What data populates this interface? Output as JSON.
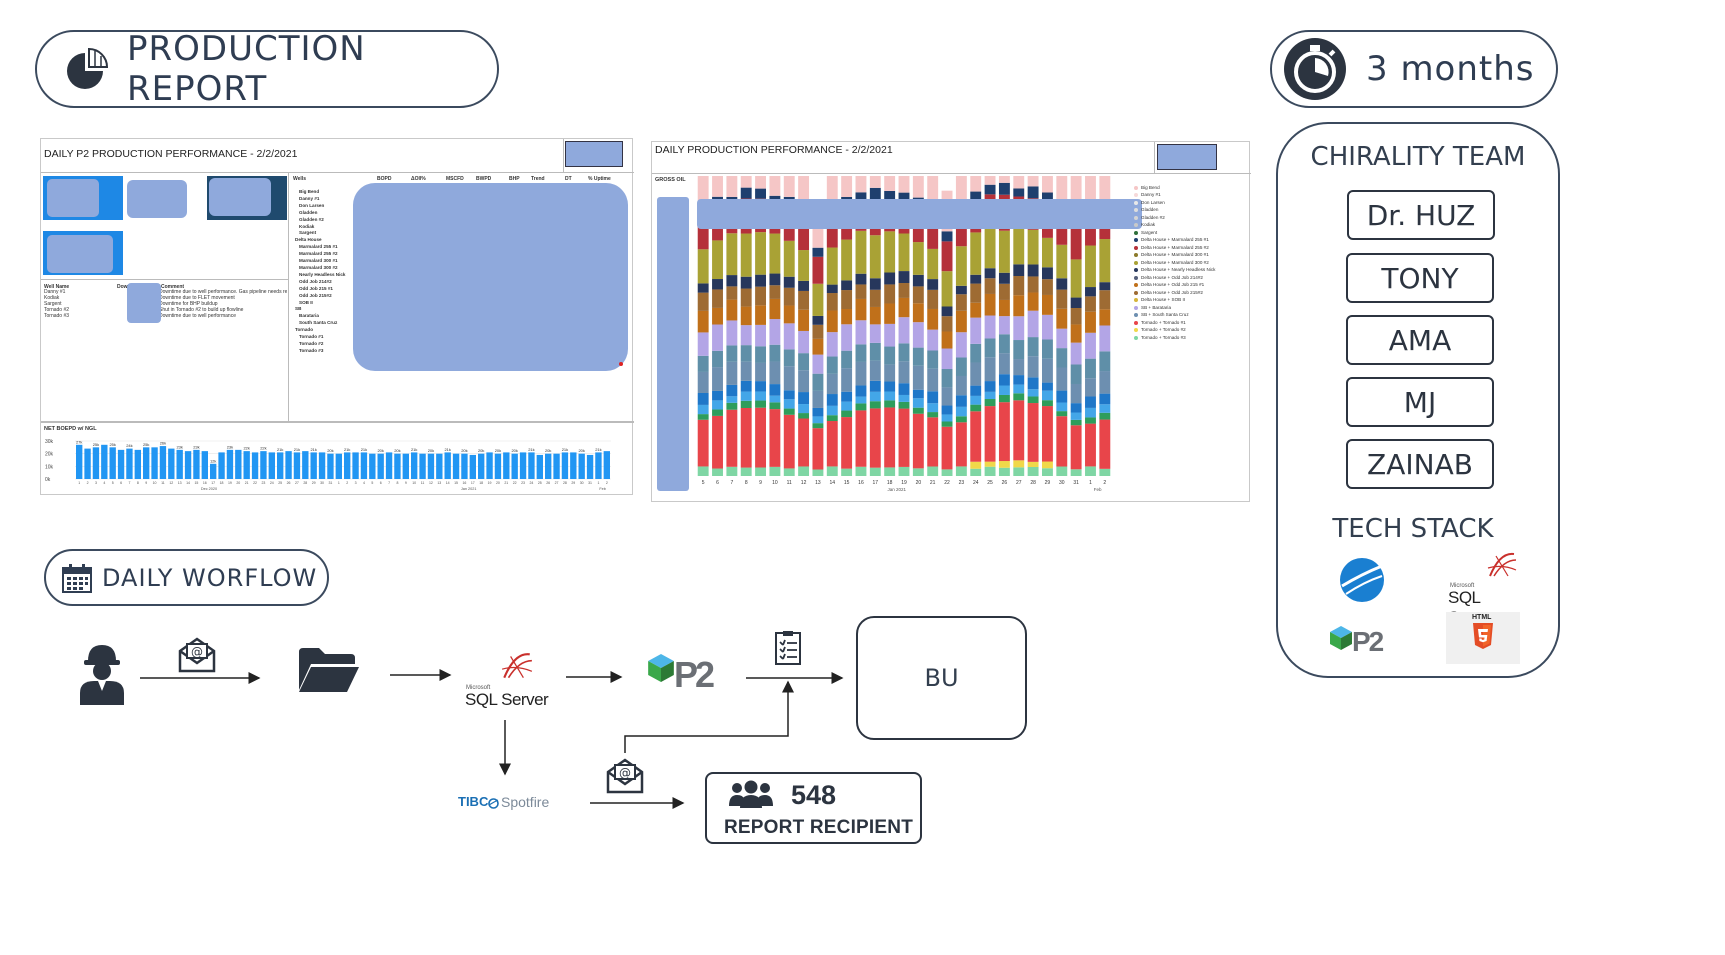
{
  "header": {
    "title": "PRODUCTION REPORT",
    "duration": "3 months"
  },
  "team": {
    "title": "CHIRALITY TEAM",
    "members": [
      "Dr. HUZ",
      "TONY",
      "AMA",
      "MJ",
      "ZAINAB"
    ]
  },
  "tech": {
    "title": "TECH STACK",
    "items": [
      "TIBCO Spotfire",
      "SQL Server",
      "P2",
      "HTML5"
    ],
    "sql_small": "Microsoft",
    "sql_label": "SQL Server",
    "p2_label": "P2",
    "html_label": "HTML"
  },
  "workflow": {
    "title": "DAILY WORFLOW",
    "bu_label": "BU",
    "recipients_count": "548",
    "recipients_label": "REPORT RECIPIENT",
    "sql_small": "Microsoft",
    "sql_label": "SQL Server",
    "p2_label": "P2",
    "spotfire_prefix": "TIBC",
    "spotfire_label": "Spotfire"
  },
  "screenshot1": {
    "title": "DAILY P2 PRODUCTION PERFORMANCE - 2/2/2021",
    "columns": [
      "Wells",
      "BOPD",
      "ΔOIl%",
      "MSCFD",
      "BWPD",
      "BHP",
      "Trend",
      "DT",
      "% Uptime"
    ],
    "wells": [
      "Big Bend",
      "Danny #1",
      "Don Larsen",
      "Gladden",
      "Gladden #2",
      "Kodiak",
      "Sargent",
      "Delta House",
      "Marmalard 255 #1",
      "Marmalard 255 #2",
      "Marmalard 300 #1",
      "Marmalard 300 #2",
      "Nearly Headless Nick",
      "Odd Job 214#2",
      "Odd Job 215 #1",
      "Odd Job 215#2",
      "SOB II",
      "SB",
      "Barataria",
      "South Santa Cruz",
      "Tornado",
      "Tornado #1",
      "Tornado #2",
      "Tornado #3"
    ],
    "notes_headers": [
      "Well Name",
      "Downtime",
      "Comment"
    ],
    "notes_wells": [
      "Danny #1",
      "Kodiak",
      "Sargent",
      "Tornado #2",
      "Tornado #3"
    ],
    "notes_comments": [
      "Downtime due to well performance. Gas pipeline needs repair",
      "Downtime due to FLET movement",
      "Downtime for BHP buildup",
      "Shut in Tornado #2 to build up flowline",
      "Downtime due to well performance"
    ],
    "chart_title": "NET BOEPD w/ NGL"
  },
  "screenshot2": {
    "title": "DAILY PRODUCTION PERFORMANCE - 2/2/2021",
    "chart_title": "GROSS OIL",
    "legend": [
      "Big Bend",
      "Danny #1",
      "Don Larsen",
      "Gladden",
      "Gladden #2",
      "Kodiak",
      "Sargent",
      "Delta House + Marmalard 255 #1",
      "Delta House + Marmalard 255 #2",
      "Delta House + Marmalard 300 #1",
      "Delta House + Marmalard 300 #2",
      "Delta House + Nearly Headless Nick",
      "Delta House + Odd Job 214#2",
      "Delta House + Odd Job 215 #1",
      "Delta House + Odd Job 215#2",
      "Delta House + SOB II",
      "SB + Barataria",
      "SB + South Santa Cruz",
      "Tornado + Tornado #1",
      "Tornado + Tornado #2",
      "Tornado + Tornado #3"
    ],
    "legend_colors": [
      "#f5c6c6",
      "#f6d9d9",
      "#e8e8e8",
      "#dddddd",
      "#d4d4d4",
      "#c9c9c9",
      "#2f6f3a",
      "#1f3f6e",
      "#b5313a",
      "#8c7a2a",
      "#a9a235",
      "#27375c",
      "#555f7a",
      "#c0701a",
      "#9e6b33",
      "#d6b53b",
      "#b3a5e6",
      "#6d8fb0",
      "#e8454a",
      "#f0d84a",
      "#7fd6a4"
    ]
  },
  "chart_data": [
    {
      "type": "bar",
      "title": "NET BOEPD w/ NGL",
      "categories": [
        "1",
        "2",
        "3",
        "4",
        "5",
        "6",
        "7",
        "8",
        "9",
        "10",
        "11",
        "12",
        "13",
        "14",
        "15",
        "16",
        "17",
        "18",
        "19",
        "20",
        "21",
        "22",
        "23",
        "24",
        "25",
        "26",
        "27",
        "28",
        "29",
        "30",
        "31",
        "1",
        "2",
        "3",
        "4",
        "5",
        "6",
        "7",
        "8",
        "9",
        "10",
        "11",
        "12",
        "13",
        "14",
        "15",
        "16",
        "17",
        "18",
        "19",
        "20",
        "21",
        "22",
        "23",
        "24",
        "25",
        "26",
        "27",
        "28",
        "29",
        "30",
        "31",
        "1",
        "2"
      ],
      "values": [
        27,
        24,
        25,
        27,
        25,
        23,
        24,
        23,
        25,
        25,
        26,
        24,
        23,
        22,
        23,
        22,
        12,
        21,
        23,
        23,
        22,
        21,
        22,
        21,
        21,
        22,
        21,
        22,
        21,
        21,
        20,
        20,
        21,
        21,
        21,
        20,
        20,
        21,
        20,
        20,
        21,
        20,
        20,
        20,
        21,
        20,
        20,
        19,
        20,
        21,
        20,
        21,
        20,
        21,
        21,
        19,
        20,
        20,
        21,
        21,
        20,
        19,
        21,
        22
      ],
      "yticks": [
        "30k",
        "20k",
        "10k",
        "0k"
      ],
      "x_group_labels": [
        "Dec 2020",
        "Jan 2021",
        "Feb"
      ],
      "ylim": [
        0,
        30
      ]
    },
    {
      "type": "bar",
      "title": "GROSS OIL",
      "categories": [
        "5",
        "6",
        "7",
        "8",
        "9",
        "10",
        "11",
        "12",
        "13",
        "14",
        "15",
        "16",
        "17",
        "18",
        "19",
        "20",
        "21",
        "22",
        "23",
        "24",
        "25",
        "26",
        "27",
        "28",
        "29",
        "30",
        "31",
        "1",
        "2"
      ],
      "x_group_labels": [
        "Jan 2021",
        "Feb"
      ]
    }
  ]
}
